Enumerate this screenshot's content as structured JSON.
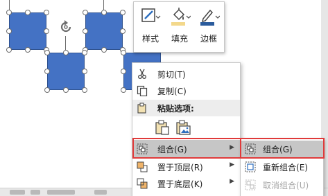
{
  "colors": {
    "shape_fill": "#4472c4",
    "highlight_red": "#e03a3a",
    "hover_gray": "#c6c6c6"
  },
  "mini_toolbar": {
    "buttons": [
      {
        "label": "样式",
        "icon": "style-icon"
      },
      {
        "label": "填充",
        "icon": "fill-bucket-icon"
      },
      {
        "label": "边框",
        "icon": "border-pen-icon"
      }
    ]
  },
  "context_menu": {
    "cut": {
      "label": "剪切",
      "mnemonic": "(T)",
      "icon": "scissors-icon"
    },
    "copy": {
      "label": "复制",
      "mnemonic": "(C)",
      "icon": "copy-icon"
    },
    "paste_options_header": "粘贴选项:",
    "paste_options": [
      {
        "icon": "paste-keep-format-icon"
      },
      {
        "icon": "paste-as-picture-icon"
      }
    ],
    "group": {
      "label": "组合",
      "mnemonic": "(G)",
      "icon": "group-icon"
    },
    "bring_to_front": {
      "label": "置于顶层",
      "mnemonic": "(R)",
      "icon": "bring-to-front-icon"
    },
    "send_to_back": {
      "label": "置于底层",
      "mnemonic": "(K)",
      "icon": "send-to-back-icon"
    }
  },
  "group_submenu": {
    "group": {
      "label": "组合",
      "mnemonic": "(G)",
      "icon": "group-icon"
    },
    "regroup": {
      "label": "重新组合",
      "mnemonic": "(E)",
      "icon": "regroup-icon"
    },
    "ungroup": {
      "label": "取消组合",
      "mnemonic": "(U)",
      "icon": "ungroup-icon"
    }
  }
}
